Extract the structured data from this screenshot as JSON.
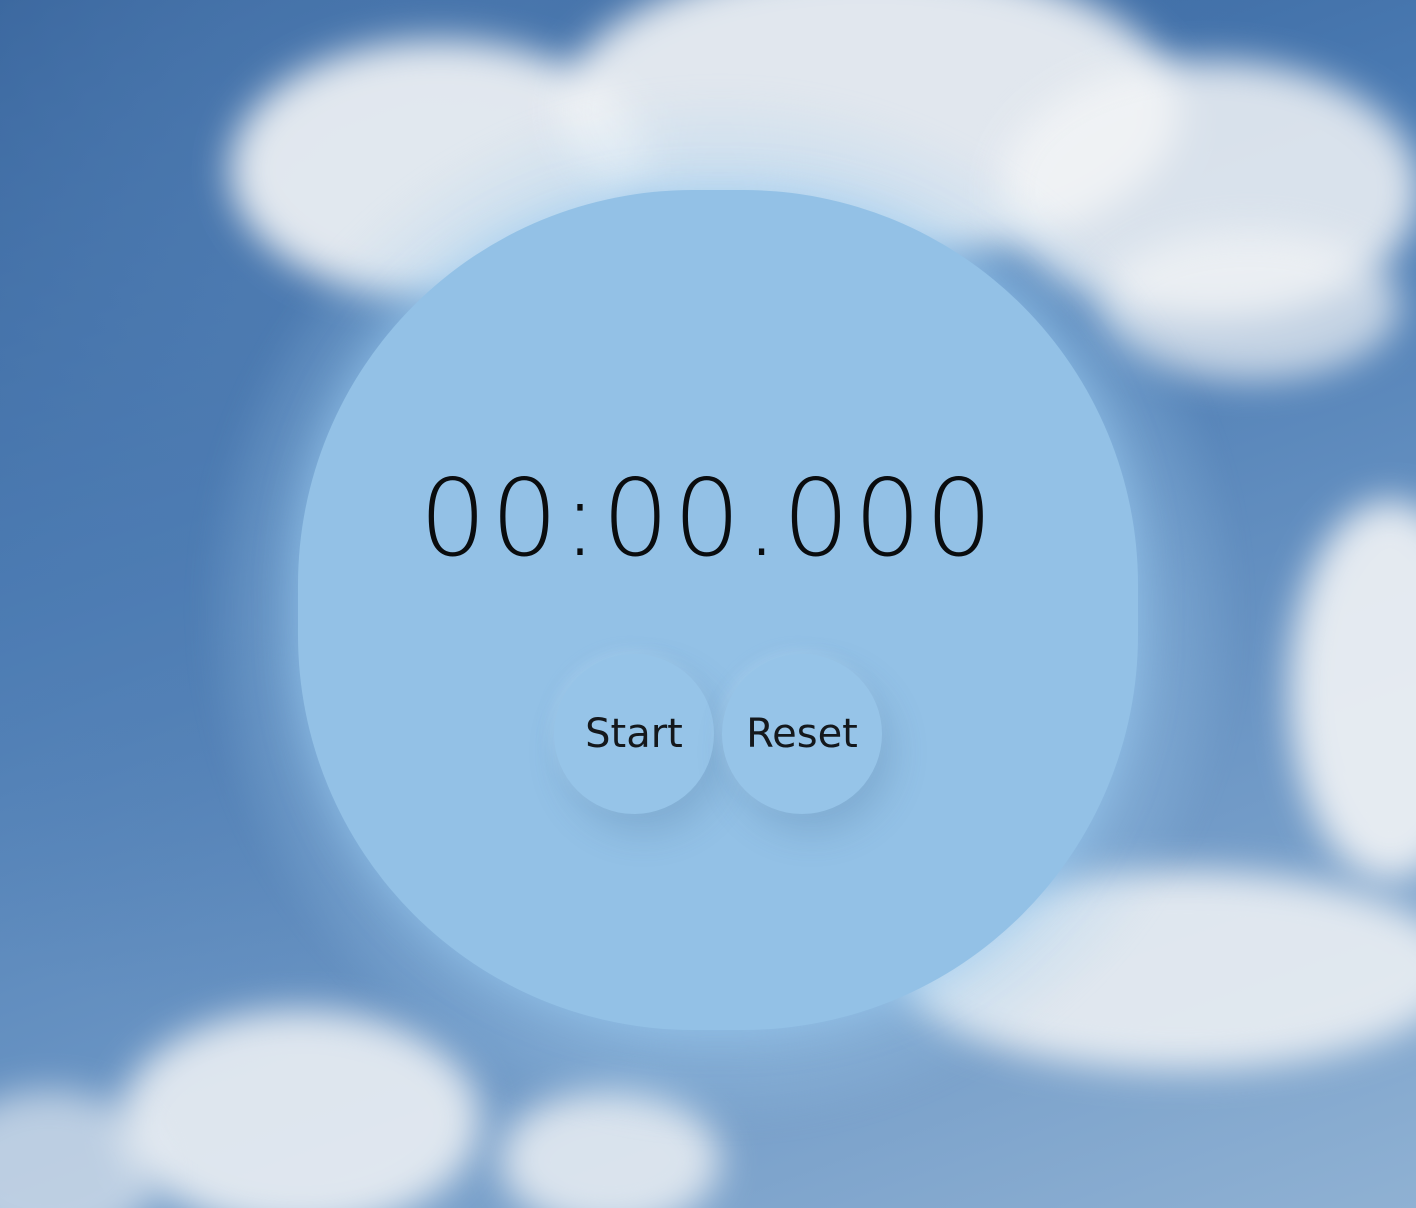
{
  "timer": {
    "display": "00:00.000"
  },
  "controls": {
    "start_label": "Start",
    "reset_label": "Reset"
  },
  "colors": {
    "dial": "#93c1e6",
    "button": "#96c4e8",
    "text": "#0a0c0e"
  }
}
